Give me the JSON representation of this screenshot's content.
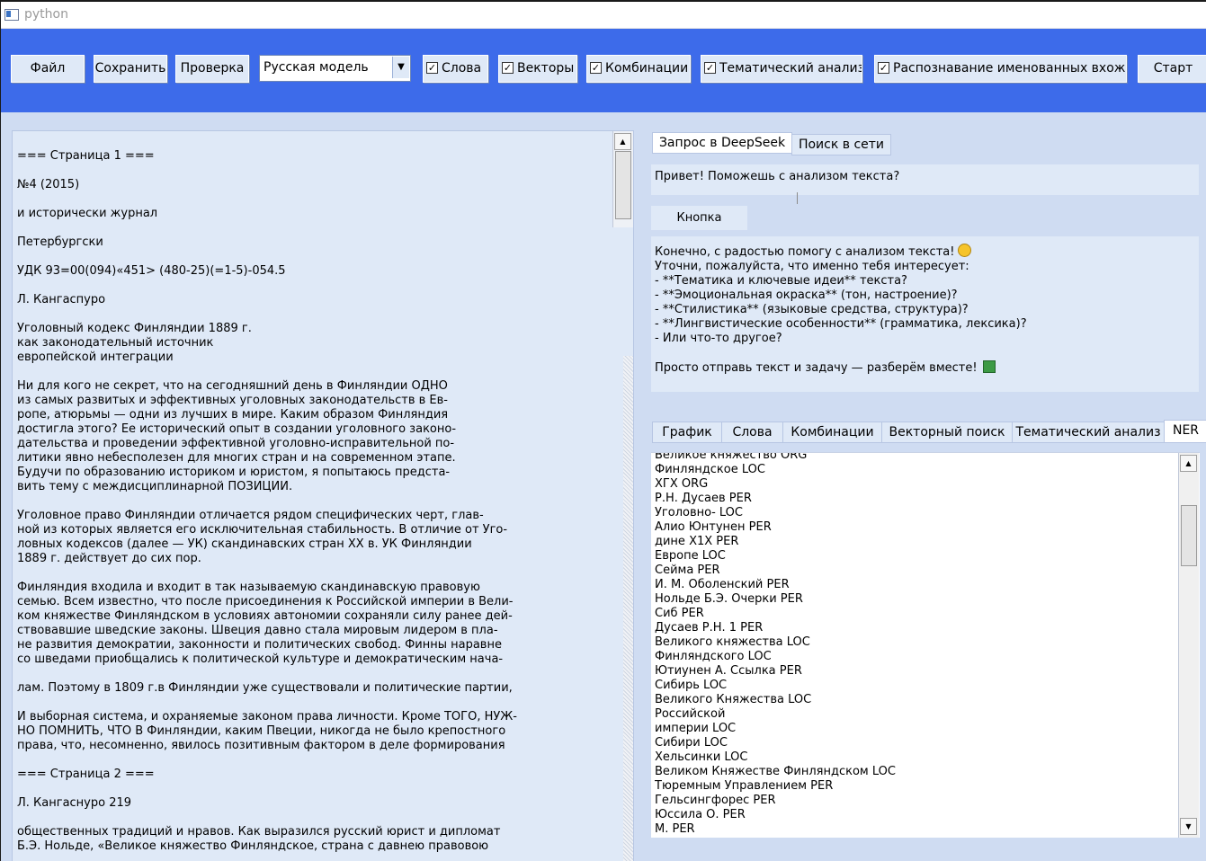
{
  "window": {
    "title": "python"
  },
  "toolbar": {
    "file_button": "Файл",
    "save_button": "Сохранить",
    "check_button": "Проверка",
    "model_select": "Русская модель",
    "checkboxes": [
      {
        "label": "Слова",
        "checked": true
      },
      {
        "label": "Векторы",
        "checked": true
      },
      {
        "label": "Комбинации",
        "checked": true
      },
      {
        "label": "Тематический анализ",
        "checked": true
      },
      {
        "label": "Распознавание именованных вхождений",
        "checked": true
      }
    ],
    "start_button": "Старт"
  },
  "document": {
    "paragraphs": [
      "=== Страница 1 ===",
      "№4 (2015)",
      "и исторически журнал",
      "Петербургски",
      "УДК 93=00(094)«451> (480-25)(=1-5)-054.5",
      "Л. Кангаспуро",
      "Уголовный кодекс Финляндии 1889 г.\nкак законодательный источник\nевропейской интеграции",
      "Ни для кого не секрет, что на сегодняшний день в Финляндии ОДНО\nиз самых развитых и эффективных уголовных законодательств в Ев-\nропе, атюрьмы — одни из лучших в мире. Каким образом Финляндия\nдостигла этого? Ее исторический опыт в создании уголовного законо-\nдательства и проведении эффективной уголовно-исправительной по-\nлитики явно небесполезен для многих стран и на современном этапе.\nБудучи по образованию историком и юристом, я попытаюсь предста-\nвить тему с междисциплинарной ПОЗИЦИИ.",
      "Уголовное право Финляндии отличается рядом специфических черт, глав-\nной из которых является его исключительная стабильность. В отличие от Уго-\nловных кодексов (далее — УК) скандинавских стран XX в. УК Финляндии\n1889 г. действует до сих пор.",
      "Финляндия входила и входит в так называемую скандинавскую правовую\nсемью. Всем известно, что после присоединения к Российской империи в Вели-\nком княжестве Финляндском в условиях автономии сохраняли силу ранее дей-\nствовавшие шведские законы. Швеция давно стала мировым лидером в пла-\nне развития демократии, законности и политических свобод. Финны наравне\nсо шведами приобщались к политической культуре и демократическим нача-",
      "лам. Поэтому в 1809 г.в Финляндии уже существовали и политические партии,",
      "И выборная система, и охраняемые законом права личности. Кроме ТОГО, НУЖ-\nНО ПОМНИТЬ, ЧТО В Финляндии, каким Пвеции, никогда не было крепостного\nправа, что, несомненно, явилось позитивным фактором в деле формирования",
      "",
      "=== Страница 2 ===",
      "Л. Кангаснуро 219",
      "общественных традиций и нравов. Как выразился русский юрист и дипломат\nБ.Э. Нольде, «Великое княжество Финляндское, страна с давнею правовою"
    ]
  },
  "chat": {
    "tabs": [
      "Запрос в DeepSeek",
      "Поиск в сети"
    ],
    "prompt": "Привет! Поможешь с анализом текста?",
    "send_button": "Кнопка",
    "response_lines": [
      "Конечно, с радостью помогу с анализом текста!",
      "Уточни, пожалуйста, что именно тебя интересует:",
      "- **Тематика и ключевые идеи** текста?",
      "- **Эмоциональная окраска** (тон, настроение)?",
      "- **Стилистика** (языковые средства, структура)?",
      "- **Лингвистические особенности** (грамматика, лексика)?",
      "- Или что-то другое?",
      "",
      "Просто отправь текст и задачу — разберём вместе!"
    ]
  },
  "results": {
    "tabs": [
      "График",
      "Слова",
      "Комбинации",
      "Векторный поиск",
      "Тематический анализ",
      "NER"
    ],
    "active_tab": "NER",
    "ner_items": [
      "Великое княжество ORG",
      "Финляндское LOC",
      "ХГХ ORG",
      "Р.Н. Дусаев PER",
      "Уголовно- LOC",
      "Алио Юнтунен PER",
      "дине X1X PER",
      "Европе LOC",
      "Сейма PER",
      "И. М. Оболенский PER",
      "Нольде Б.Э. Очерки PER",
      "Сиб PER",
      "Дусаев Р.Н. 1 PER",
      "Великого княжества LOC",
      "Финляндского LOC",
      "Ютиунен А. Ссылка PER",
      "Сибирь LOC",
      "Великого Княжества LOC",
      "Российской",
      "империи LOC",
      "Сибири LOC",
      "Хельсинки LOC",
      "Великом Княжестве Финляндском LOC",
      "Тюремным Управлением PER",
      "Гельсингфорес PER",
      "Юссила О. PER",
      "М. PER"
    ]
  }
}
